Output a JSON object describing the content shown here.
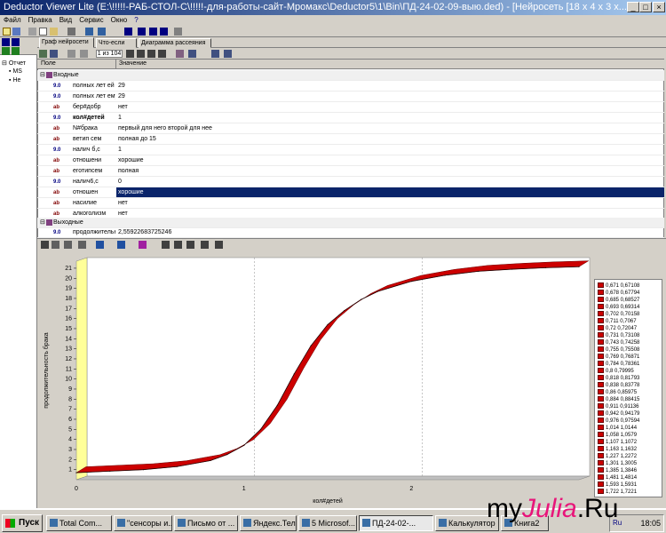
{
  "window": {
    "title": "Deductor Viewer Lite (E:\\!!!!!-РАБ-СТОЛ-С\\!!!!!-для-работы-сайт-Мромакс\\Deductor5\\1\\Bin\\ПД-24-02-09-выю.ded) - [Нейросеть [18 x 4 x 3 x..."
  },
  "menu": [
    "Файл",
    "Правка",
    "Вид",
    "Сервис",
    "Окно",
    "?"
  ],
  "tree": [
    {
      "label": "Отчет"
    },
    {
      "label": "MS"
    },
    {
      "label": "Не"
    }
  ],
  "tabs": [
    {
      "label": "Граф нейросети"
    },
    {
      "label": "Что-если"
    },
    {
      "label": "Диаграмма рассеяния"
    }
  ],
  "nav": {
    "page": "1 из 104"
  },
  "grid": {
    "headers": [
      "Поле",
      "Значение"
    ],
    "input_group": "Входные",
    "output_group": "Выходные",
    "rows": [
      {
        "type": "9.0",
        "name": "полных лет ей на...",
        "value": "29"
      },
      {
        "type": "9.0",
        "name": "полных лет ему н...",
        "value": "29"
      },
      {
        "type": "ab",
        "name": "бер#добр",
        "value": "нет"
      },
      {
        "type": "9.0",
        "name": "кол#детей",
        "value": "1"
      },
      {
        "type": "ab",
        "name": "N#брака",
        "value": "первый для него второй для нее"
      },
      {
        "type": "ab",
        "name": "ветип сем",
        "value": "полная до 15"
      },
      {
        "type": "9.0",
        "name": "налич б,с",
        "value": "1"
      },
      {
        "type": "ab",
        "name": "отношени",
        "value": "хорошие"
      },
      {
        "type": "ab",
        "name": "еготипсем",
        "value": "полная"
      },
      {
        "type": "9.0",
        "name": "налич6,с",
        "value": "0"
      },
      {
        "type": "ab",
        "name": "отношен",
        "value": "хорошие"
      },
      {
        "type": "ab",
        "name": "насилие",
        "value": "нет"
      },
      {
        "type": "ab",
        "name": "алкоголизм",
        "value": "нет"
      }
    ],
    "output_rows": [
      {
        "type": "9.0",
        "name": "продолжительно...",
        "value": "2,55922683725246"
      }
    ]
  },
  "chart_data": {
    "type": "area",
    "xlabel": "кол#детей",
    "ylabel": "продолжительность брака",
    "x_ticks": [
      "0",
      "1",
      "2"
    ],
    "y_ticks": [
      "1",
      "2",
      "3",
      "4",
      "5",
      "6",
      "7",
      "8",
      "9",
      "10",
      "11",
      "12",
      "13",
      "14",
      "15",
      "16",
      "17",
      "18",
      "19",
      "20",
      "21"
    ],
    "xlim": [
      0,
      3
    ],
    "ylim": [
      0,
      21.7
    ],
    "series": [
      {
        "x": [
          0,
          0.2,
          0.4,
          0.6,
          0.8,
          0.9,
          1.0,
          1.1,
          1.2,
          1.3,
          1.4,
          1.5,
          1.6,
          1.7,
          1.8,
          2.0,
          2.2,
          2.4,
          2.6,
          2.8,
          3.0
        ],
        "values": [
          0.7,
          0.85,
          1.0,
          1.3,
          1.9,
          2.5,
          3.4,
          5.0,
          7.4,
          10.5,
          13.3,
          15.4,
          16.8,
          17.9,
          18.7,
          19.7,
          20.3,
          20.7,
          20.9,
          21.05,
          21.15
        ]
      }
    ],
    "legend": [
      "0,671 0,67108",
      "0,678 0,67794",
      "0,685 0,68527",
      "0,693 0,69314",
      "0,702 0,70158",
      "0,711 0,7067",
      "0,72 0,72047",
      "0,731 0,73108",
      "0,743 0,74258",
      "0,755 0,75508",
      "0,769 0,76871",
      "0,784 0,78361",
      "0,8 0,79995",
      "0,818 0,81793",
      "0,838 0,83778",
      "0,86 0,85975",
      "0,884 0,88415",
      "0,911 0,91136",
      "0,942 0,94179",
      "0,976 0,97594",
      "1,014 1,0144",
      "1,058 1,0579",
      "1,107 1,1072",
      "1,163 1,1632",
      "1,227 1,2272",
      "1,301 1,3005",
      "1,385 1,3846",
      "1,481 1,4814",
      "1,593 1,5931",
      "1,722 1,7221"
    ],
    "colors": {
      "fill": "#cc0000",
      "wall": "#ffff99",
      "floor": "#c0c0c0"
    }
  },
  "taskbar": {
    "start": "Пуск",
    "tasks": [
      "Total Com...",
      "\"сенсоры и...",
      "Письмо от ...",
      "Яндекс.Тел...",
      "5 Microsof...",
      "ПД-24-02-...",
      "Калькулятор",
      "Книга2"
    ],
    "clock": "18:05",
    "lang": "Ru"
  },
  "watermark": {
    "prefix": "my",
    "mid": "Julia",
    "suffix": ".Ru"
  }
}
